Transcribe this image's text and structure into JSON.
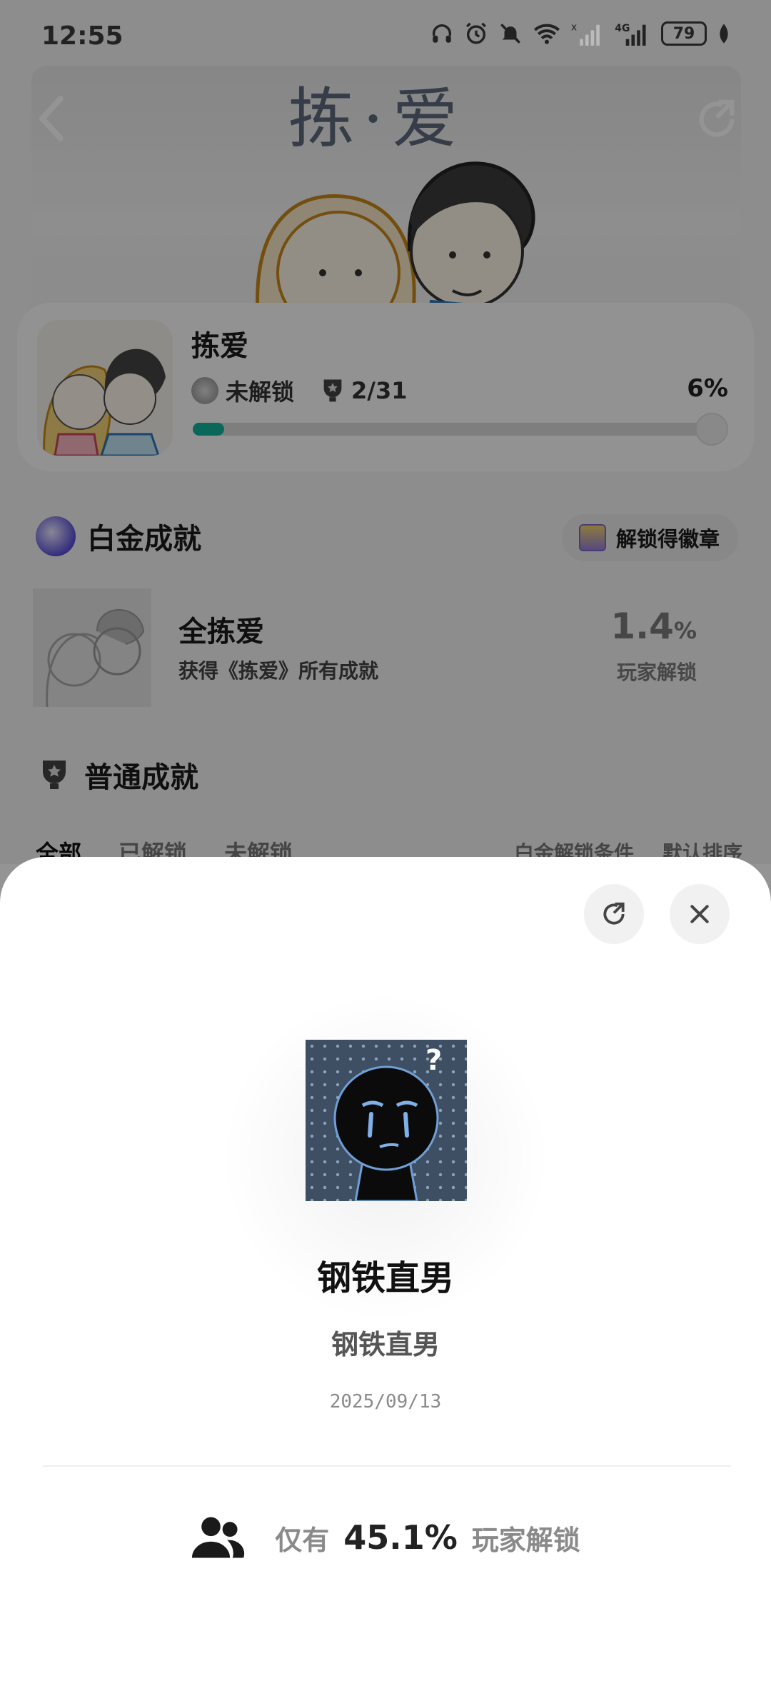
{
  "status_bar": {
    "time": "12:55",
    "battery": "79",
    "network": "4G"
  },
  "game": {
    "banner_title": "拣·爱",
    "name": "拣爱",
    "lock_state": "未解锁",
    "trophies": "2/31",
    "progress_percent": "6%",
    "progress_value": 0.06
  },
  "platinum": {
    "section_title": "白金成就",
    "badge_button": "解锁得徽章",
    "title": "全拣爱",
    "description": "获得《拣爱》所有成就",
    "rate_value": "1.4",
    "rate_unit": "%",
    "rate_label": "玩家解锁"
  },
  "normal": {
    "section_title": "普通成就",
    "tabs": [
      "全部",
      "已解锁",
      "未解锁"
    ],
    "filter_label": "白金解锁条件",
    "sort_label": "默认排序"
  },
  "sheet": {
    "title": "钢铁直男",
    "subtitle": "钢铁直男",
    "date": "2025/09/13",
    "stat_prefix": "仅有",
    "stat_value": "45.1%",
    "stat_suffix": "玩家解锁"
  },
  "icons": {
    "back": "chevron-left-icon",
    "share": "share-icon",
    "close": "close-icon",
    "users": "users-icon",
    "trophy": "trophy-icon"
  }
}
